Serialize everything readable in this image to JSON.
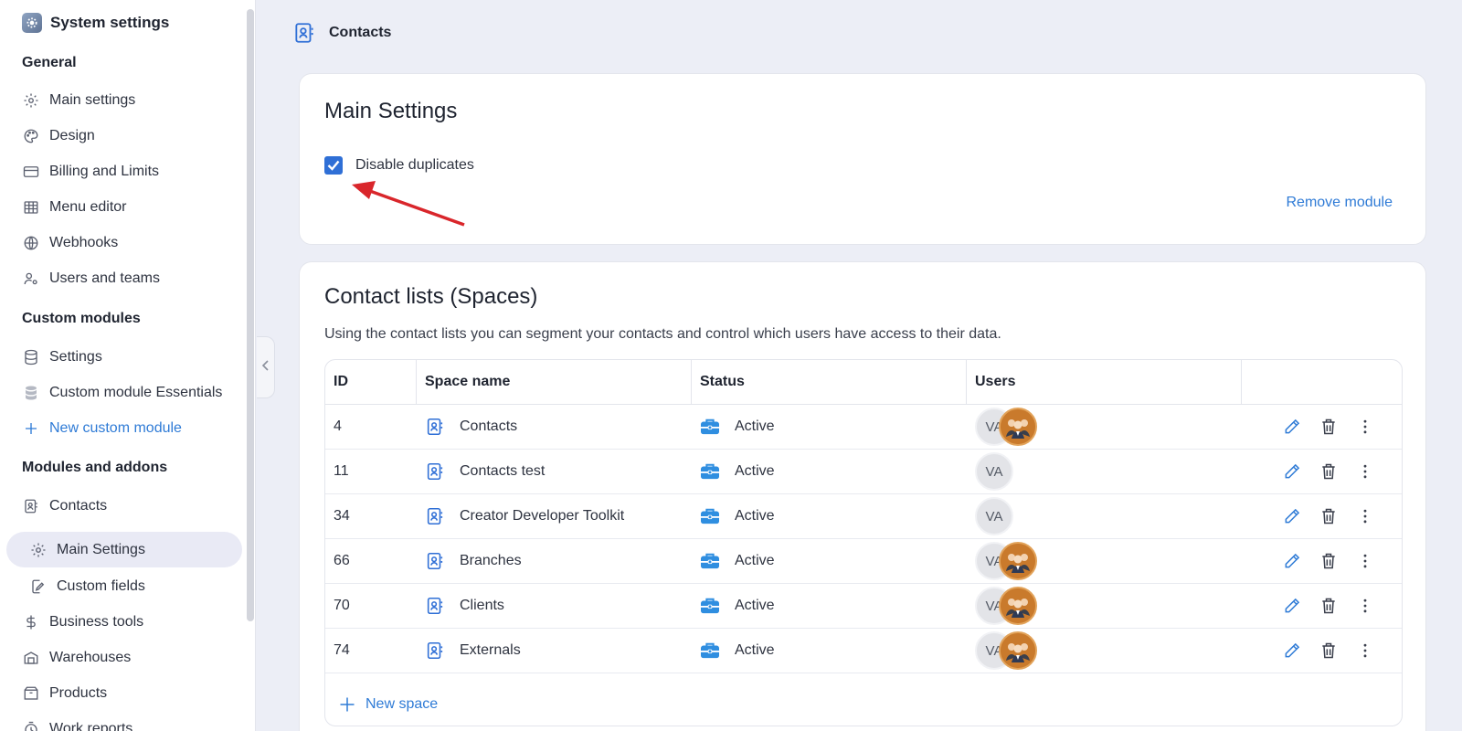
{
  "sidebar": {
    "app_title": "System settings",
    "sections": {
      "general": "General",
      "custom_modules": "Custom modules",
      "modules_addons": "Modules and addons"
    },
    "general_items": [
      {
        "label": "Main settings",
        "icon": "gear-icon"
      },
      {
        "label": "Design",
        "icon": "palette-icon"
      },
      {
        "label": "Billing and Limits",
        "icon": "credit-card-icon"
      },
      {
        "label": "Menu editor",
        "icon": "grid-icon"
      },
      {
        "label": "Webhooks",
        "icon": "globe-icon"
      },
      {
        "label": "Users and teams",
        "icon": "users-gear-icon"
      }
    ],
    "custom_module_items": [
      {
        "label": "Settings",
        "icon": "database-icon"
      },
      {
        "label": "Custom module Essentials",
        "icon": "database-filled-icon"
      },
      {
        "label": "New custom module",
        "icon": "plus-icon"
      }
    ],
    "module_items": [
      {
        "label": "Contacts",
        "icon": "contact-book-icon"
      },
      {
        "label": "Main Settings",
        "icon": "gear-icon"
      },
      {
        "label": "Custom fields",
        "icon": "edit-doc-icon"
      },
      {
        "label": "Business tools",
        "icon": "dollar-icon"
      },
      {
        "label": "Warehouses",
        "icon": "warehouse-icon"
      },
      {
        "label": "Products",
        "icon": "box-icon"
      },
      {
        "label": "Work reports",
        "icon": "clock-icon"
      }
    ]
  },
  "header": {
    "title": "Contacts"
  },
  "main_settings_card": {
    "title": "Main Settings",
    "checkbox_label": "Disable duplicates",
    "checkbox_checked": true,
    "remove_link": "Remove module"
  },
  "contact_lists_card": {
    "title": "Contact lists (Spaces)",
    "description": "Using the contact lists you can segment your contacts and control which users have access to their data.",
    "columns": {
      "id": "ID",
      "name": "Space name",
      "status": "Status",
      "users": "Users",
      "actions": ""
    },
    "rows": [
      {
        "id": "4",
        "name": "Contacts",
        "status": "Active",
        "avatar": "VA",
        "has_group": true
      },
      {
        "id": "11",
        "name": "Contacts test",
        "status": "Active",
        "avatar": "VA",
        "has_group": false
      },
      {
        "id": "34",
        "name": "Creator Developer Toolkit",
        "status": "Active",
        "avatar": "VA",
        "has_group": false
      },
      {
        "id": "66",
        "name": "Branches",
        "status": "Active",
        "avatar": "VA",
        "has_group": true
      },
      {
        "id": "70",
        "name": "Clients",
        "status": "Active",
        "avatar": "VA",
        "has_group": true
      },
      {
        "id": "74",
        "name": "Externals",
        "status": "Active",
        "avatar": "VA",
        "has_group": true
      }
    ],
    "new_space_label": "New space"
  },
  "colors": {
    "accent": "#2f7bd6",
    "checkbox": "#2f6fd6",
    "arrow": "#d9262b",
    "status_icon": "#2f8ee0"
  }
}
